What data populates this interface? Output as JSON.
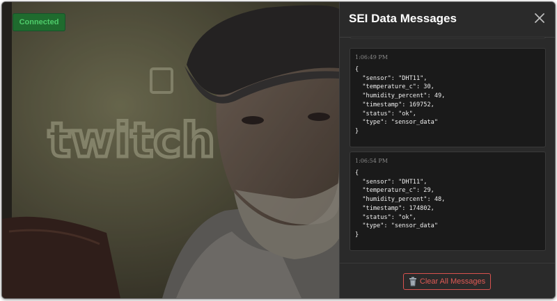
{
  "video": {
    "status_badge": "Connected",
    "wall_sign_text": "twitch"
  },
  "panel": {
    "title": "SEI Data Messages",
    "messages": [
      {
        "time": "1:06:49 PM",
        "body": "{\n  \"sensor\": \"DHT11\",\n  \"temperature_c\": 30,\n  \"humidity_percent\": 49,\n  \"timestamp\": 169752,\n  \"status\": \"ok\",\n  \"type\": \"sensor_data\"\n}"
      },
      {
        "time": "1:06:54 PM",
        "body": "{\n  \"sensor\": \"DHT11\",\n  \"temperature_c\": 29,\n  \"humidity_percent\": 48,\n  \"timestamp\": 174802,\n  \"status\": \"ok\",\n  \"type\": \"sensor_data\"\n}"
      }
    ],
    "clear_button_label": "Clear All Messages"
  },
  "icons": {
    "close": "close-icon",
    "trash": "trash-icon"
  },
  "colors": {
    "connected_bg": "#1f6b2e",
    "connected_text": "#4ecb6a",
    "danger": "#d9534f",
    "panel_bg": "#2a2a2a",
    "card_bg": "#1a1a1a"
  }
}
